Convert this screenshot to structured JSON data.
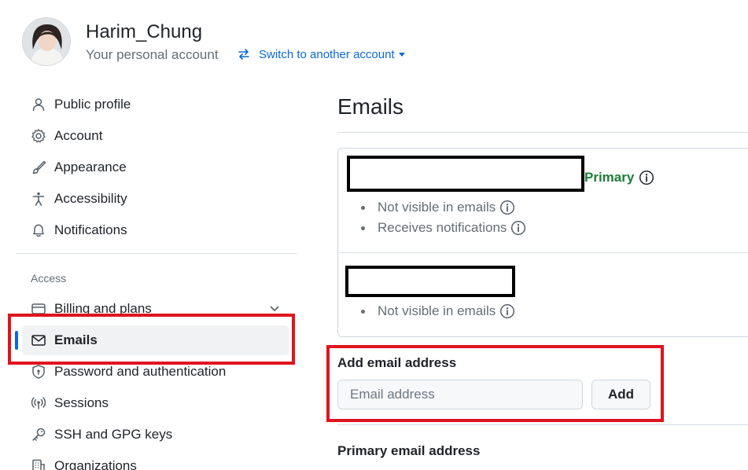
{
  "account": {
    "username": "Harim_Chung",
    "subtitle": "Your personal account",
    "switch_label": "Switch to another account"
  },
  "sidebar": {
    "items": [
      {
        "label": "Public profile",
        "icon": "person-icon"
      },
      {
        "label": "Account",
        "icon": "gear-icon"
      },
      {
        "label": "Appearance",
        "icon": "paintbrush-icon"
      },
      {
        "label": "Accessibility",
        "icon": "accessibility-icon"
      },
      {
        "label": "Notifications",
        "icon": "bell-icon"
      }
    ],
    "section_access": "Access",
    "access_items": [
      {
        "label": "Billing and plans",
        "icon": "credit-card-icon"
      },
      {
        "label": "Emails",
        "icon": "mail-icon",
        "active": true
      },
      {
        "label": "Password and authentication",
        "icon": "shield-lock-icon"
      },
      {
        "label": "Sessions",
        "icon": "broadcast-icon"
      },
      {
        "label": "SSH and GPG keys",
        "icon": "key-icon"
      },
      {
        "label": "Organizations",
        "icon": "organization-icon"
      }
    ]
  },
  "main": {
    "title": "Emails",
    "emails": [
      {
        "badge": "Primary",
        "notes": [
          "Not visible in emails",
          "Receives notifications"
        ]
      },
      {
        "notes": [
          "Not visible in emails"
        ]
      }
    ],
    "add_email": {
      "label": "Add email address",
      "placeholder": "Email address",
      "button": "Add"
    },
    "primary_heading": "Primary email address"
  },
  "colors": {
    "link": "#0969da",
    "primary_badge": "#1a7f37",
    "highlight": "#e0141e",
    "active_indicator": "#0969da"
  }
}
